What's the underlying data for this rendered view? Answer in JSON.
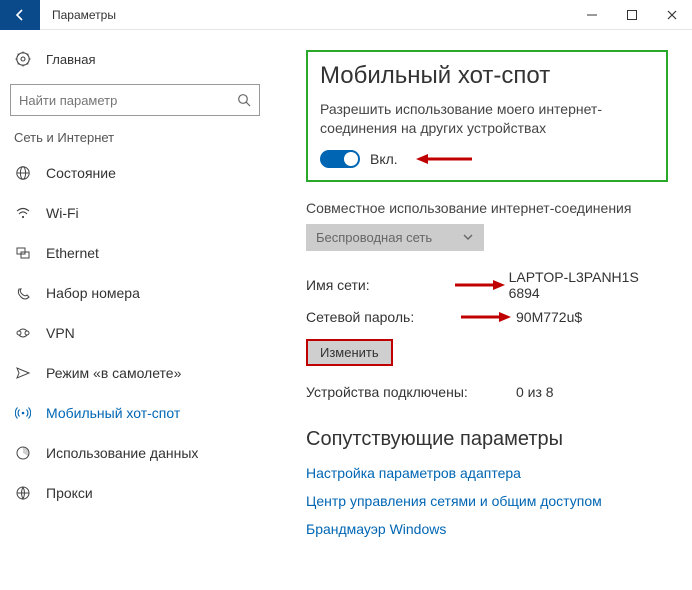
{
  "titlebar": {
    "title": "Параметры"
  },
  "sidebar": {
    "home": "Главная",
    "search_placeholder": "Найти параметр",
    "section": "Сеть и Интернет",
    "items": [
      {
        "label": "Состояние"
      },
      {
        "label": "Wi-Fi"
      },
      {
        "label": "Ethernet"
      },
      {
        "label": "Набор номера"
      },
      {
        "label": "VPN"
      },
      {
        "label": "Режим «в самолете»"
      },
      {
        "label": "Мобильный хот-спот"
      },
      {
        "label": "Использование данных"
      },
      {
        "label": "Прокси"
      }
    ]
  },
  "main": {
    "title": "Мобильный хот-спот",
    "description": "Разрешить использование моего интернет-соединения на других устройствах",
    "toggle_label": "Вкл.",
    "share_heading": "Совместное использование интернет-соединения",
    "dropdown_value": "Беспроводная сеть",
    "network_name_label": "Имя сети:",
    "network_name_value": "LAPTOP-L3PANH1S 6894",
    "password_label": "Сетевой пароль:",
    "password_value": "90M772u$",
    "edit_button": "Изменить",
    "devices_label": "Устройства подключены:",
    "devices_value": "0 из 8",
    "related_title": "Сопутствующие параметры",
    "links": [
      "Настройка параметров адаптера",
      "Центр управления сетями и общим доступом",
      "Брандмауэр Windows"
    ]
  }
}
